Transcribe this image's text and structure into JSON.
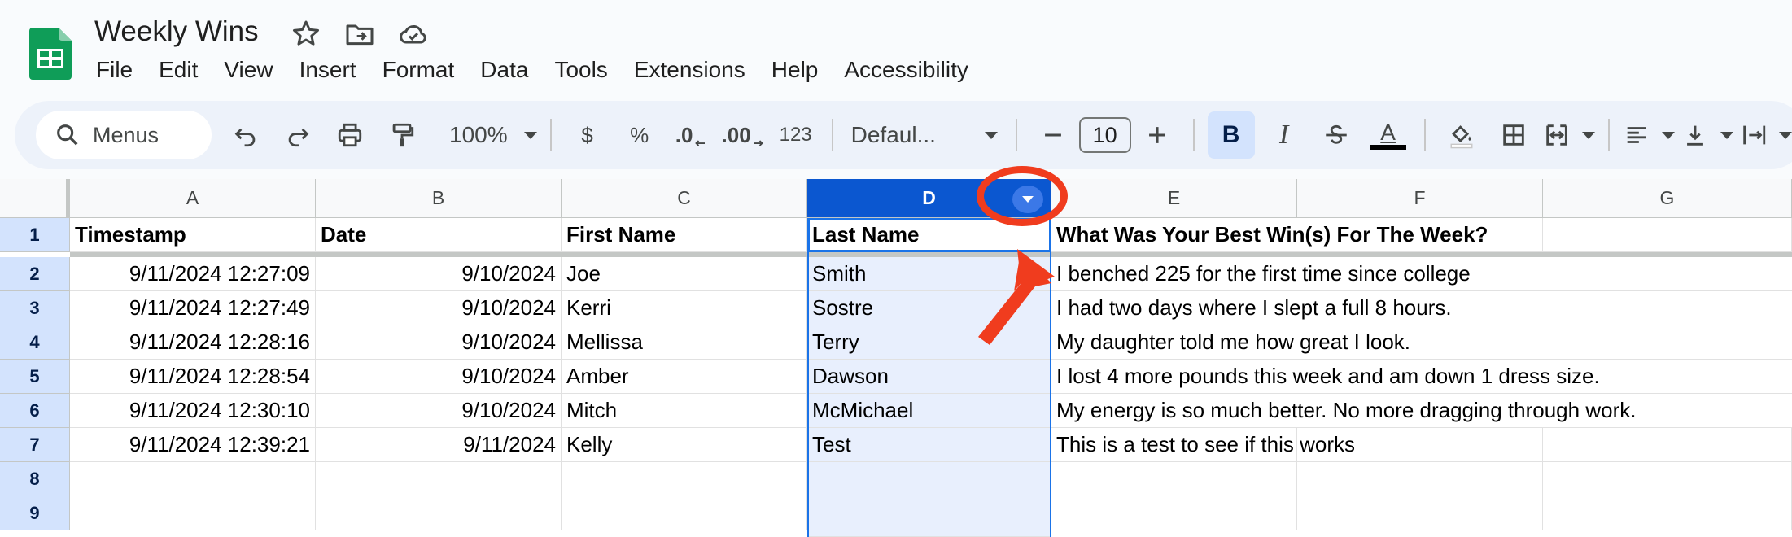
{
  "app": {
    "doc_title": "Weekly Wins",
    "icons": [
      "star-icon",
      "move-to-folder-icon",
      "cloud-saved-icon"
    ]
  },
  "menu": [
    "File",
    "Edit",
    "View",
    "Insert",
    "Format",
    "Data",
    "Tools",
    "Extensions",
    "Help",
    "Accessibility"
  ],
  "toolbar": {
    "search_placeholder": "Menus",
    "zoom": "100%",
    "currency": "$",
    "percent": "%",
    "decrease_decimal": ".0",
    "increase_decimal": ".00",
    "number_format": "123",
    "font": "Defaul...",
    "font_size": "10",
    "bold": "B",
    "italic": "I",
    "text_color": "A"
  },
  "columns": [
    "A",
    "B",
    "C",
    "D",
    "E",
    "F",
    "G"
  ],
  "selected_column": "D",
  "rows": [
    "1",
    "2",
    "3",
    "4",
    "5",
    "6",
    "7",
    "8",
    "9"
  ],
  "table": {
    "headers": [
      "Timestamp",
      "Date",
      "First Name",
      "Last Name",
      "What Was Your Best Win(s) For The Week?"
    ],
    "data": [
      [
        "9/11/2024 12:27:09",
        "9/10/2024",
        "Joe",
        "Smith",
        "I benched 225 for the first time since college"
      ],
      [
        "9/11/2024 12:27:49",
        "9/10/2024",
        "Kerri",
        "Sostre",
        "I had two days where I slept a full 8 hours."
      ],
      [
        "9/11/2024 12:28:16",
        "9/10/2024",
        "Mellissa",
        "Terry",
        "My daughter told me how great I look."
      ],
      [
        "9/11/2024 12:28:54",
        "9/10/2024",
        "Amber",
        "Dawson",
        "I lost 4 more pounds this week and am down 1 dress size."
      ],
      [
        "9/11/2024 12:30:10",
        "9/10/2024",
        "Mitch",
        "McMichael",
        "My energy is so much better. No more dragging through work."
      ],
      [
        "9/11/2024 12:39:21",
        "9/11/2024",
        "Kelly",
        "Test",
        "This is a test to see if this works"
      ]
    ]
  },
  "colors": {
    "accent": "#0b57d0",
    "annotation": "#f03c1e"
  }
}
